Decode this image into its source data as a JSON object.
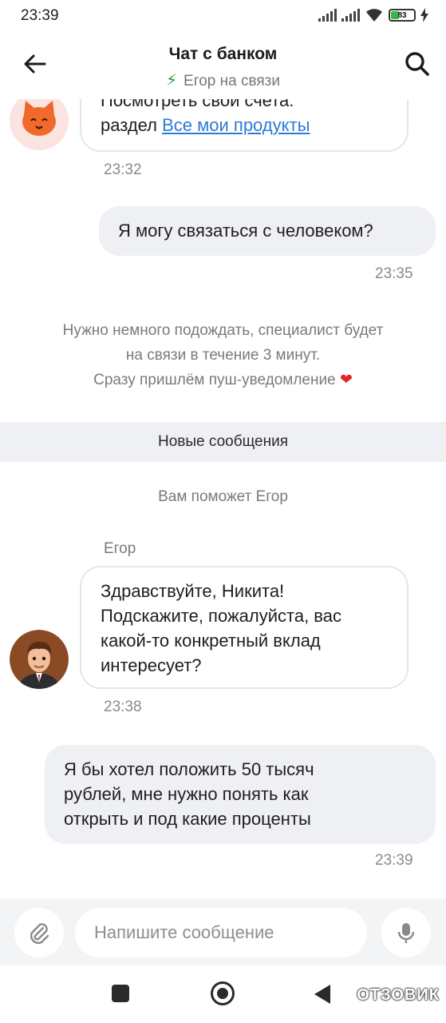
{
  "status_bar": {
    "time": "23:39",
    "battery": "83"
  },
  "header": {
    "title": "Чат с банком",
    "subtitle": "Егор на связи"
  },
  "messages": {
    "m1": {
      "line1": "Посмотреть свои счета:",
      "line2_prefix": "раздел ",
      "link": "Все мои продукты",
      "time": "23:32"
    },
    "m2": {
      "text": "Я могу связаться с человеком?",
      "time": "23:35"
    },
    "system": {
      "line1": "Нужно немного подождать, специалист будет",
      "line2": "на связи в течение 3 минут.",
      "line3": "Сразу пришлём пуш-уведомление",
      "emoji": "❤️"
    },
    "divider": "Новые сообщения",
    "assigned": "Вам поможет Егор",
    "m3": {
      "sender": "Егор",
      "line1": "Здравствуйте, Никита!",
      "line2": "Подскажите, пожалуйста, вас",
      "line3": "какой-то конкретный вклад",
      "line4": "интересует?",
      "time": "23:38"
    },
    "m4": {
      "line1": "Я бы хотел положить 50 тысяч",
      "line2": "рублей, мне нужно понять как",
      "line3": "открыть и под какие проценты",
      "time": "23:39"
    }
  },
  "composer": {
    "placeholder": "Напишите сообщение"
  },
  "watermark": "ОТЗОВИК",
  "colors": {
    "accent_green": "#21a038",
    "link_blue": "#2b7bd8",
    "heart_red": "#e0242b",
    "outgoing_bubble": "#eef0f3"
  }
}
